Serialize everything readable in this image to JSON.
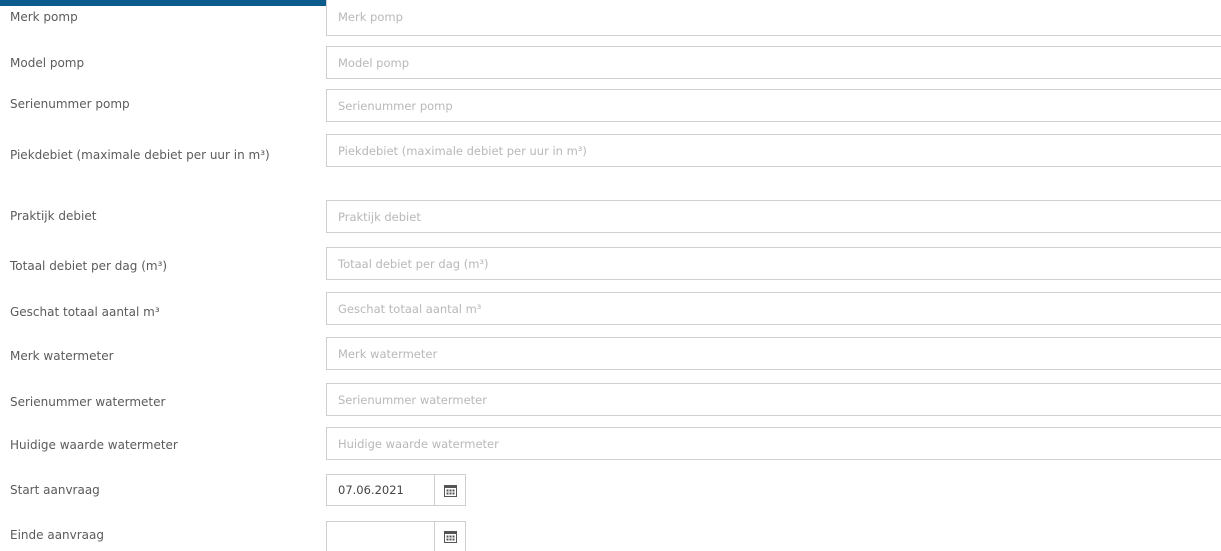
{
  "form": {
    "fields": [
      {
        "label": "Merk pomp",
        "placeholder": "Merk pomp"
      },
      {
        "label": "Model pomp",
        "placeholder": "Model pomp"
      },
      {
        "label": "Serienummer pomp",
        "placeholder": "Serienummer pomp"
      },
      {
        "label": "Piekdebiet (maximale debiet per uur in m³)",
        "placeholder": "Piekdebiet (maximale debiet per uur in m³)"
      },
      {
        "label": "Praktijk debiet",
        "placeholder": "Praktijk debiet"
      },
      {
        "label": "Totaal debiet per dag (m³)",
        "placeholder": "Totaal debiet per dag (m³)"
      },
      {
        "label": "Geschat totaal aantal m³",
        "placeholder": "Geschat totaal aantal m³"
      },
      {
        "label": "Merk watermeter",
        "placeholder": "Merk watermeter"
      },
      {
        "label": "Serienummer watermeter",
        "placeholder": "Serienummer watermeter"
      },
      {
        "label": "Huidige waarde watermeter",
        "placeholder": "Huidige waarde watermeter"
      }
    ],
    "start": {
      "label": "Start aanvraag",
      "value": "07.06.2021"
    },
    "end": {
      "label": "Einde aanvraag",
      "value": ""
    }
  },
  "icons": {
    "calendar": "calendar-icon"
  },
  "colors": {
    "header_bar": "#0b5b8c",
    "border": "#cfcfcf",
    "placeholder": "#b8b8b8"
  }
}
